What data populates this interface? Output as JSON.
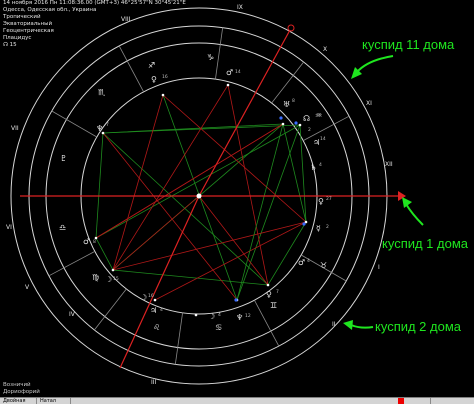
{
  "header": {
    "line1": "14 ноября 2016  Пн  11:08:36.00 (GMT+3)  46°25'57\"N  30°45'21\"E",
    "line2": "Одесса, Одесская обл., Украина",
    "line3": "Тропический",
    "line4": "Экваториальный",
    "line5": "Геоцентрическая",
    "line6": "Плацидус",
    "line7": "15"
  },
  "houses": {
    "I": "I",
    "II": "II",
    "III": "III",
    "IV": "IV",
    "V": "V",
    "VI": "VI",
    "VII": "VII",
    "VIII": "VIII",
    "IX": "IX",
    "X": "X",
    "XI": "XI",
    "XII": "XII"
  },
  "annotations": {
    "cusp11": "куспид 11 дома",
    "cusp1": "куспид 1 дома",
    "cusp2": "куспид 2 дома"
  },
  "bottom_left": {
    "line1": "Возничий",
    "line2": "Дориофорий"
  },
  "status_bar": {
    "cell1": "Двойная",
    "cell2": "Натал"
  },
  "colors": {
    "background": "#000000",
    "annotation_green": "#1fe61f",
    "axis_red": "#dd2222",
    "aspect_green": "#1e8a1e",
    "aspect_red": "#b01818",
    "circle": "#d8d8d8"
  }
}
